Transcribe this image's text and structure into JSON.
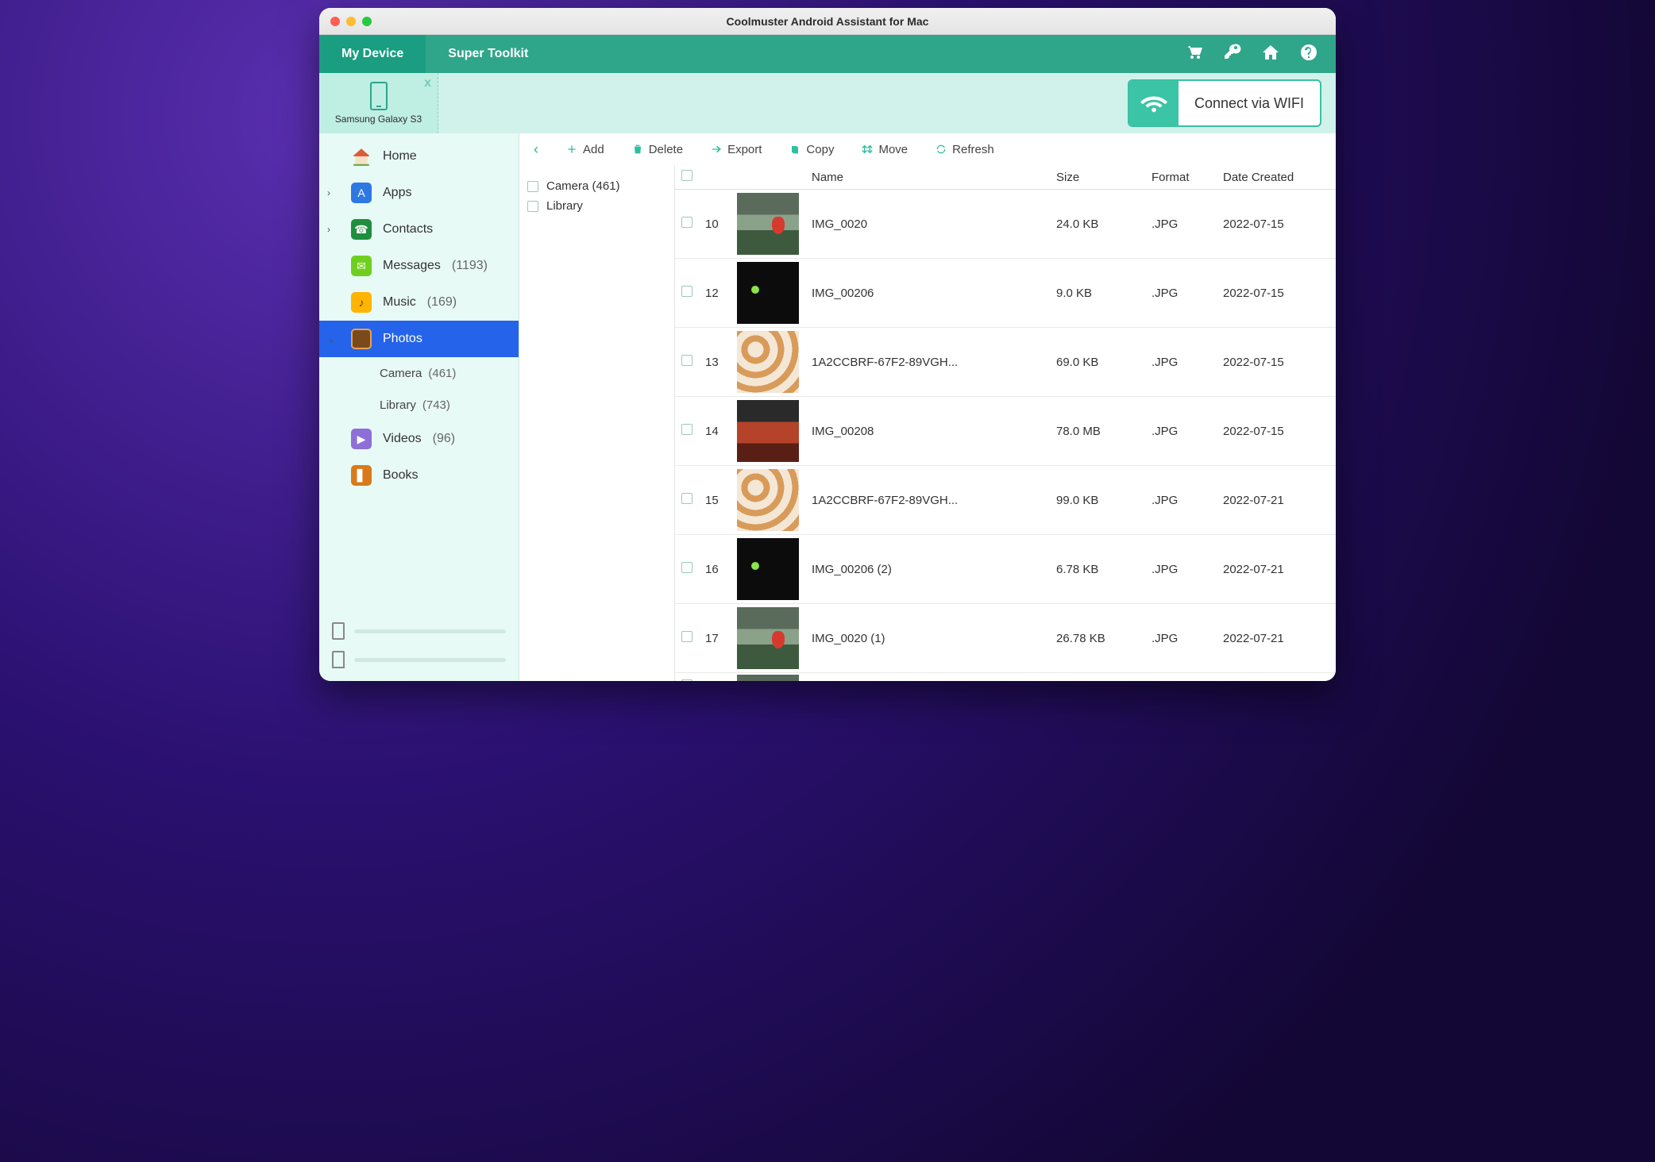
{
  "window": {
    "title": "Coolmuster Android Assistant for Mac"
  },
  "tabs": {
    "device": "My Device",
    "toolkit": "Super Toolkit"
  },
  "device": {
    "name": "Samsung Galaxy S3"
  },
  "connect": {
    "label": "Connect via WIFI"
  },
  "sidebar": {
    "home": "Home",
    "apps": "Apps",
    "contacts": "Contacts",
    "messages": {
      "label": "Messages",
      "count": "(1193)"
    },
    "music": {
      "label": "Music",
      "count": "(169)"
    },
    "photos": "Photos",
    "camera": {
      "label": "Camera",
      "count": "(461)"
    },
    "library": {
      "label": "Library",
      "count": "(743)"
    },
    "videos": {
      "label": "Videos",
      "count": "(96)"
    },
    "books": "Books"
  },
  "toolbar": {
    "add": "Add",
    "delete": "Delete",
    "export": "Export",
    "copy": "Copy",
    "move": "Move",
    "refresh": "Refresh"
  },
  "folders": [
    {
      "label": "Camera (461)"
    },
    {
      "label": "Library"
    }
  ],
  "columns": {
    "name": "Name",
    "size": "Size",
    "format": "Format",
    "date": "Date Created"
  },
  "rows": [
    {
      "idx": "10",
      "thumb": "t-red",
      "name": "IMG_0020",
      "size": "24.0 KB",
      "fmt": ".JPG",
      "date": "2022-07-15"
    },
    {
      "idx": "12",
      "thumb": "t-cat",
      "name": "IMG_00206",
      "size": "9.0 KB",
      "fmt": ".JPG",
      "date": "2022-07-15"
    },
    {
      "idx": "13",
      "thumb": "t-pump",
      "name": "1A2CCBRF-67F2-89VGH...",
      "size": "69.0 KB",
      "fmt": ".JPG",
      "date": "2022-07-15"
    },
    {
      "idx": "14",
      "thumb": "t-sky",
      "name": "IMG_00208",
      "size": "78.0 MB",
      "fmt": ".JPG",
      "date": "2022-07-15"
    },
    {
      "idx": "15",
      "thumb": "t-pump",
      "name": "1A2CCBRF-67F2-89VGH...",
      "size": "99.0 KB",
      "fmt": ".JPG",
      "date": "2022-07-21"
    },
    {
      "idx": "16",
      "thumb": "t-cat",
      "name": "IMG_00206 (2)",
      "size": "6.78 KB",
      "fmt": ".JPG",
      "date": "2022-07-21"
    },
    {
      "idx": "17",
      "thumb": "t-red",
      "name": "IMG_0020 (1)",
      "size": "26.78 KB",
      "fmt": ".JPG",
      "date": "2022-07-21"
    }
  ]
}
